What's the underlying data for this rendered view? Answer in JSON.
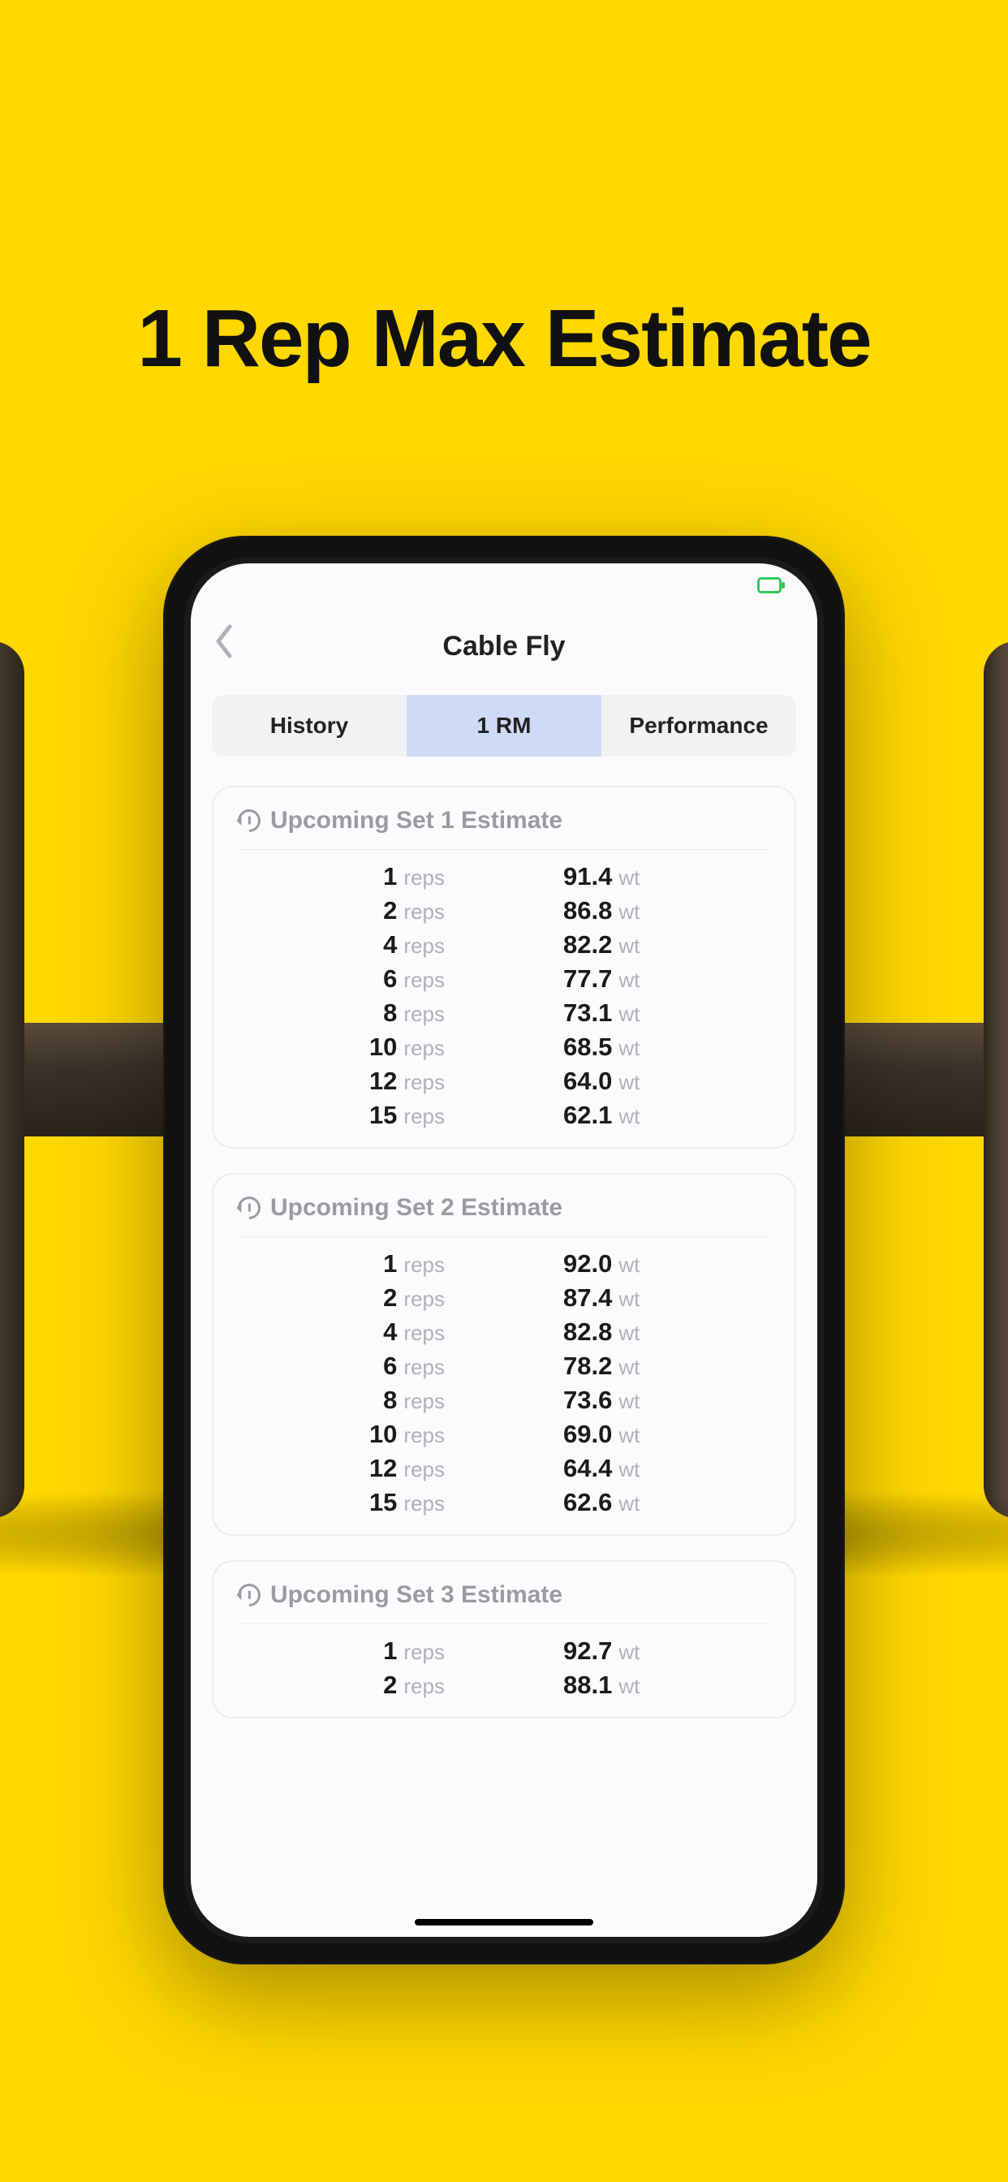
{
  "promo": {
    "headline": "1 Rep Max Estimate"
  },
  "nav": {
    "title": "Cable Fly"
  },
  "tabs": {
    "history": "History",
    "one_rm": "1 RM",
    "performance": "Performance"
  },
  "units": {
    "reps": "reps",
    "wt": "wt"
  },
  "cards": [
    {
      "title": "Upcoming Set 1 Estimate",
      "rows": [
        {
          "reps": "1",
          "wt": "91.4"
        },
        {
          "reps": "2",
          "wt": "86.8"
        },
        {
          "reps": "4",
          "wt": "82.2"
        },
        {
          "reps": "6",
          "wt": "77.7"
        },
        {
          "reps": "8",
          "wt": "73.1"
        },
        {
          "reps": "10",
          "wt": "68.5"
        },
        {
          "reps": "12",
          "wt": "64.0"
        },
        {
          "reps": "15",
          "wt": "62.1"
        }
      ]
    },
    {
      "title": "Upcoming Set 2 Estimate",
      "rows": [
        {
          "reps": "1",
          "wt": "92.0"
        },
        {
          "reps": "2",
          "wt": "87.4"
        },
        {
          "reps": "4",
          "wt": "82.8"
        },
        {
          "reps": "6",
          "wt": "78.2"
        },
        {
          "reps": "8",
          "wt": "73.6"
        },
        {
          "reps": "10",
          "wt": "69.0"
        },
        {
          "reps": "12",
          "wt": "64.4"
        },
        {
          "reps": "15",
          "wt": "62.6"
        }
      ]
    },
    {
      "title": "Upcoming Set 3 Estimate",
      "rows": [
        {
          "reps": "1",
          "wt": "92.7"
        },
        {
          "reps": "2",
          "wt": "88.1"
        }
      ]
    }
  ]
}
